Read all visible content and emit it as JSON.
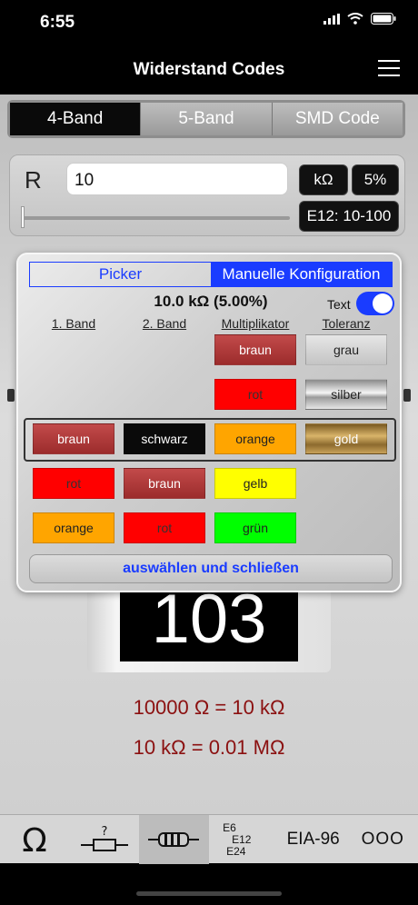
{
  "status": {
    "time": "6:55"
  },
  "nav": {
    "title": "Widerstand Codes"
  },
  "segments": [
    "4-Band",
    "5-Band",
    "SMD Code"
  ],
  "resistor": {
    "label": "R",
    "value": "10",
    "unit": "kΩ",
    "tolerance": "5%",
    "series": "E12: 10-100",
    "slider_fraction": 0.0
  },
  "popup": {
    "tabs": [
      "Picker",
      "Manuelle Konfiguration"
    ],
    "value": "10.0 kΩ (5.00%)",
    "text_toggle_label": "Text",
    "columns": [
      "1. Band",
      "2. Band",
      "Multiplikator",
      "Toleranz"
    ],
    "rows": [
      [
        "",
        "",
        "braun",
        "grau"
      ],
      [
        "",
        "",
        "rot",
        "silber"
      ],
      [
        "braun",
        "schwarz",
        "orange",
        "gold"
      ],
      [
        "rot",
        "braun",
        "gelb",
        ""
      ],
      [
        "orange",
        "rot",
        "grün",
        ""
      ]
    ],
    "close_label": "auswählen und schließen"
  },
  "colors": {
    "braun": "#b33a3a",
    "schwarz": "#0a0a0a",
    "rot": "#ff0000",
    "orange": "#ffa500",
    "gelb": "#ffff00",
    "grün": "#00ff00",
    "grau": "#d4d4d4",
    "silber": "#c0c0c0",
    "gold": "#b8893c",
    "accent": "#1a3cff",
    "conversion": "#8b1010"
  },
  "smd": {
    "code": "103"
  },
  "conversions": [
    "10000 Ω = 10 kΩ",
    "10 kΩ = 0.01 MΩ"
  ],
  "tabbar": {
    "items": [
      "omega-icon",
      "unknown-resistor-icon",
      "resistor-icon",
      "E6",
      "EIA-96",
      "ooo"
    ],
    "e_series": [
      "E6",
      "E12",
      "E24"
    ],
    "eia": "EIA-96",
    "more": "OOO"
  }
}
